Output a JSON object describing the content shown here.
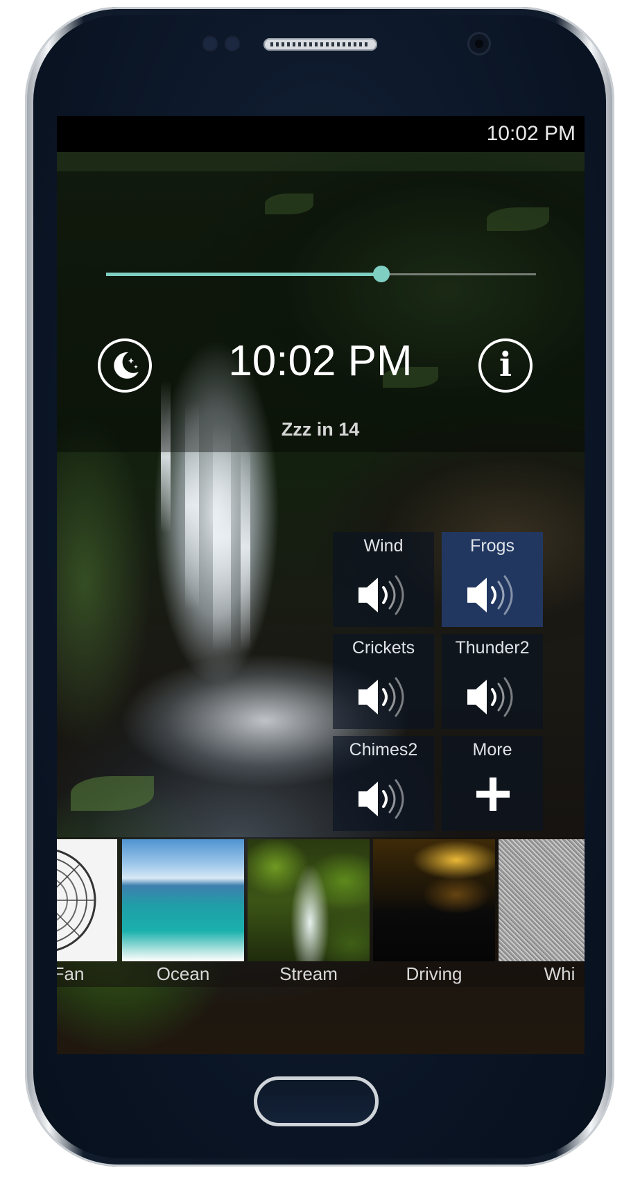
{
  "status_bar": {
    "time": "10:02 PM"
  },
  "volume_slider": {
    "value_percent": 64
  },
  "header": {
    "clock": "10:02 PM",
    "sleep_timer": "Zzz in 14",
    "moon_icon": "moon-stars-icon",
    "info_icon": "info-icon",
    "info_glyph": "i"
  },
  "sounds": [
    {
      "label": "Wind",
      "icon": "speaker-icon",
      "active": false
    },
    {
      "label": "Frogs",
      "icon": "speaker-icon",
      "active": true
    },
    {
      "label": "Crickets",
      "icon": "speaker-icon",
      "active": false
    },
    {
      "label": "Thunder2",
      "icon": "speaker-icon",
      "active": false
    },
    {
      "label": "Chimes2",
      "icon": "speaker-icon",
      "active": false
    },
    {
      "label": "More",
      "icon": "plus-icon",
      "active": false
    }
  ],
  "scenes": [
    {
      "label": "ng Fan"
    },
    {
      "label": "Ocean"
    },
    {
      "label": "Stream"
    },
    {
      "label": "Driving"
    },
    {
      "label": "Whi"
    }
  ],
  "colors": {
    "accent": "#7fcfc3",
    "active_tile": "#213760",
    "status_bar": "#000000"
  }
}
